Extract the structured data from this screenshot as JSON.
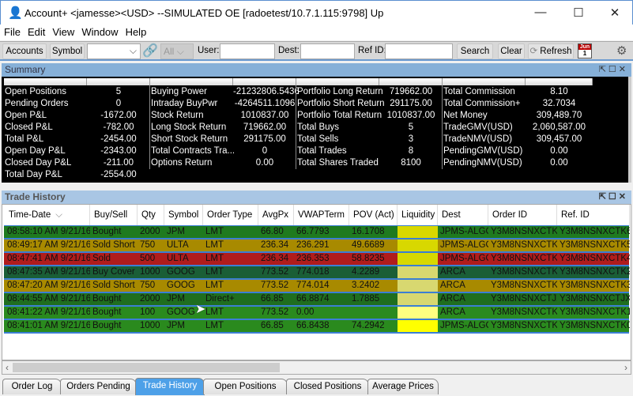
{
  "window": {
    "title": "Account+ <jamesse><USD> --SIMULATED OE [radoetest/10.7.1.115:9798] Up",
    "minimize": "—",
    "maximize": "☐",
    "close": "✕"
  },
  "menu": [
    "File",
    "Edit",
    "View",
    "Window",
    "Help"
  ],
  "toolbar": {
    "accounts": "Accounts",
    "symbol": "Symbol",
    "symbol_value": "",
    "all": "All",
    "user_label": "User:",
    "user_value": "",
    "dest_label": "Dest:",
    "dest_value": "",
    "refid_label": "Ref ID:",
    "refid_value": "",
    "search": "Search",
    "clear": "Clear",
    "refresh": "Refresh",
    "calendar_month": "Jun",
    "calendar_day": "1"
  },
  "summary": {
    "title": "Summary",
    "col1": [
      [
        "Open Positions",
        "5"
      ],
      [
        "Pending Orders",
        "0"
      ],
      [
        "Open P&L",
        "-1672.00"
      ],
      [
        "Closed P&L",
        "-782.00"
      ],
      [
        "Total P&L",
        "-2454.00"
      ],
      [
        "Open Day P&L",
        "-2343.00"
      ],
      [
        "Closed Day P&L",
        "-211.00"
      ],
      [
        "Total Day P&L",
        "-2554.00"
      ]
    ],
    "col2": [
      [
        "Buying Power",
        "-21232806.5436"
      ],
      [
        "Intraday BuyPwr",
        "-4264511.1096"
      ],
      [
        "Stock Return",
        "1010837.00"
      ],
      [
        "Long Stock Return",
        "719662.00"
      ],
      [
        "Short Stock Return",
        "291175.00"
      ],
      [
        "Total Contracts Tra...",
        "0"
      ],
      [
        "Options Return",
        "0.00"
      ]
    ],
    "col3": [
      [
        "Portfolio Long Return",
        "719662.00"
      ],
      [
        "Portfolio Short Return",
        "291175.00"
      ],
      [
        "Portfolio Total Return",
        "1010837.00"
      ],
      [
        "Total Buys",
        "5"
      ],
      [
        "Total Sells",
        "3"
      ],
      [
        "Total Trades",
        "8"
      ],
      [
        "Total Shares Traded",
        "8100"
      ]
    ],
    "col4": [
      [
        "Total Commission",
        "8.10"
      ],
      [
        "Total Commission+",
        "32.7034"
      ],
      [
        "Net Money",
        "309,489.70"
      ],
      [
        "TradeGMV(USD)",
        "2,060,587.00"
      ],
      [
        "TradeNMV(USD)",
        "309,457.00"
      ],
      [
        "PendingGMV(USD)",
        "0.00"
      ],
      [
        "PendingNMV(USD)",
        "0.00"
      ]
    ]
  },
  "trade_history": {
    "title": "Trade History",
    "columns": [
      "Time-Date",
      "Buy/Sell",
      "Qty",
      "Symbol",
      "Order Type",
      "AvgPx",
      "VWAPTerm",
      "POV (Act)",
      "Liquidity",
      "Dest",
      "Order ID",
      "Ref. ID"
    ],
    "rows": [
      {
        "cells": [
          "08:58:10 AM 9/21/16",
          "Bought",
          "2000",
          "JPM",
          "LMT",
          "66.80",
          "66.7793",
          "16.1708",
          "",
          "JPMS-ALGO",
          "Y3M8NSNXCTK6",
          "Y3M8NSNXCTK6"
        ],
        "color": "#1f7a1f",
        "liq": "#d8d800"
      },
      {
        "cells": [
          "08:49:17 AM 9/21/16",
          "Sold Short",
          "750",
          "ULTA",
          "LMT",
          "236.34",
          "236.291",
          "49.6689",
          "",
          "JPMS-ALGO",
          "Y3M8NSNXCTK5",
          "Y3M8NSNXCTK5"
        ],
        "color": "#a88a00",
        "liq": "#d8d800"
      },
      {
        "cells": [
          "08:47:41 AM 9/21/16",
          "Sold",
          "500",
          "ULTA",
          "LMT",
          "236.34",
          "236.353",
          "58.8235",
          "",
          "JPMS-ALGO",
          "Y3M8NSNXCTK4",
          "Y3M8NSNXCTK4"
        ],
        "color": "#b01c1c",
        "liq": "#d8d800"
      },
      {
        "cells": [
          "08:47:35 AM 9/21/16",
          "Buy Cover",
          "1000",
          "GOOG",
          "LMT",
          "773.52",
          "774.018",
          "4.2289",
          "",
          "ARCA",
          "Y3M8NSNXCTK2",
          "Y3M8NSNXCTK2"
        ],
        "color": "#1a5e36",
        "liq": "#d8d870"
      },
      {
        "cells": [
          "08:47:20 AM 9/21/16",
          "Sold Short",
          "750",
          "GOOG",
          "LMT",
          "773.52",
          "774.014",
          "3.2402",
          "",
          "ARCA",
          "Y3M8NSNXCTK3",
          "Y3M8NSNXCTK3"
        ],
        "color": "#a88a00",
        "liq": "#d8d870"
      },
      {
        "cells": [
          "08:44:55 AM 9/21/16",
          "Bought",
          "2000",
          "JPM",
          "Direct+",
          "66.85",
          "66.8874",
          "1.7885",
          "",
          "ARCA",
          "Y3M8NSNXCTJX",
          "Y3M8NSNXCTJX"
        ],
        "color": "#1f6e1f",
        "liq": "#d8d870"
      },
      {
        "cells": [
          "08:41:22 AM 9/21/16",
          "Bought",
          "100",
          "GOOG",
          "LMT",
          "773.52",
          "0.00",
          "",
          "",
          "ARCA",
          "Y3M8NSNXCTK1",
          "Y3M8NSNXCTK1"
        ],
        "color": "#2a8a1e",
        "liq": "#ffff80"
      },
      {
        "cells": [
          "08:41:01 AM 9/21/16",
          "Bought",
          "1000",
          "JPM",
          "LMT",
          "66.85",
          "66.8438",
          "74.2942",
          "",
          "JPMS-ALGO",
          "Y3M8NSNXCTK0",
          "Y3M8NSNXCTK0"
        ],
        "color": "#2a8a1e",
        "liq": "#ffff00"
      }
    ]
  },
  "tabs": [
    {
      "label": "Order Log"
    },
    {
      "label": "Orders Pending"
    },
    {
      "label": "Trade History",
      "active": true
    },
    {
      "label": "Open Positions"
    },
    {
      "label": "Closed Positions"
    },
    {
      "label": "Average Prices"
    }
  ]
}
